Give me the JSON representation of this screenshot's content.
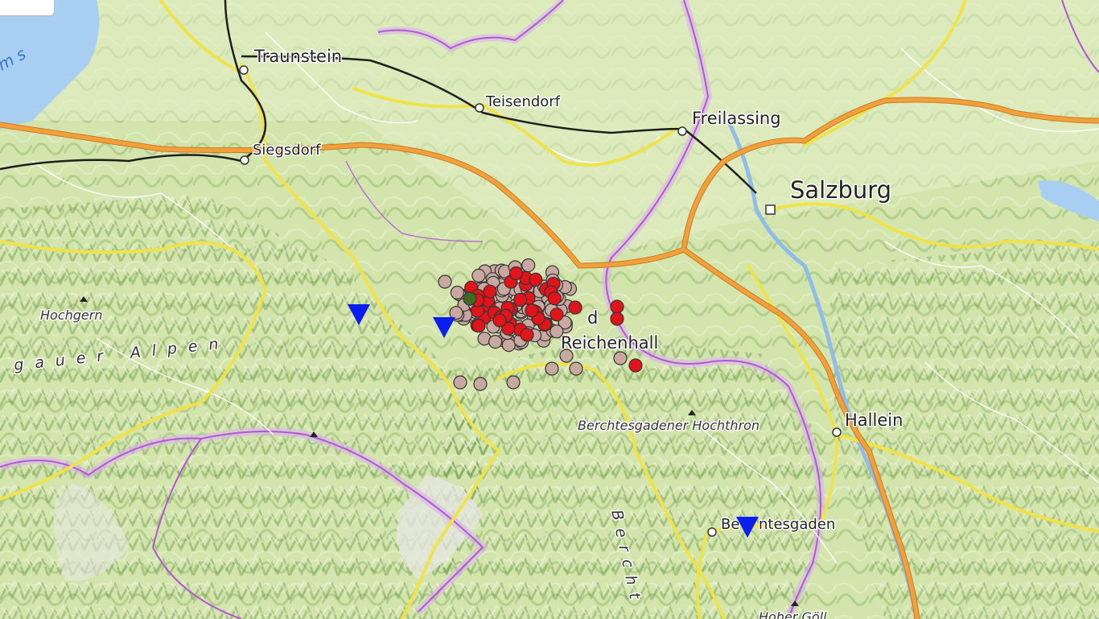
{
  "map": {
    "places": {
      "traunstein": "Traunstein",
      "teisendorf": "Teisendorf",
      "freilassing": "Freilassing",
      "siegsdorf": "Siegsdorf",
      "salzburg": "Salzburg",
      "reichenhall_prefix": "d",
      "reichenhall": "Reichenhall",
      "hallein": "Hallein",
      "berchtesgaden": "Berchtesgaden",
      "berchtesgaden_partial": "Be",
      "berchtesgaden_rest": "ntesgaden"
    },
    "peaks": {
      "hochgern": "Hochgern",
      "hochthron": "Berchtesgadener Hochthron",
      "hoher_goll": "Hoher Göll"
    },
    "regions": {
      "chiemgauer_alpen": "gauer Alpen",
      "berchtesgadener": "Bercht",
      "chiemsee_partial": "ms"
    },
    "colors": {
      "event_red": "#e0141a",
      "event_pink": "#c9a8a1",
      "event_green": "#3d6b22",
      "station_blue": "#0a1ef0",
      "border": "#b356d6",
      "motorway": "#f2a03c",
      "road": "#f0e34a",
      "water": "#a8cff2"
    },
    "icons": [
      "station-triangle-icon",
      "peak-triangle-icon",
      "city-marker-icon"
    ]
  }
}
